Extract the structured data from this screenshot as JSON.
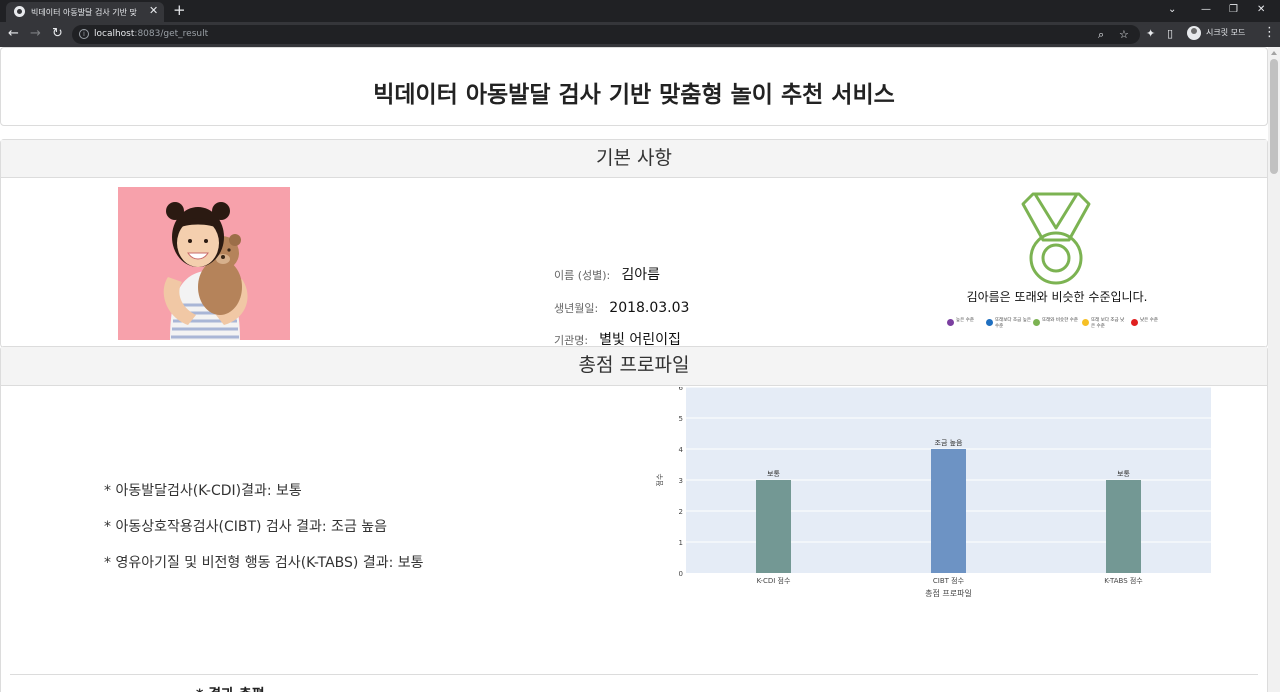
{
  "browser": {
    "tab_title": "빅데이터 아동발달 검사 기반 맞",
    "url_host": "localhost",
    "url_rest": ":8083/get_result",
    "profile_label": "시크릿 모드"
  },
  "page": {
    "title": "빅데이터 아동발달 검사 기반 맞춤형 놀이 추천 서비스",
    "basic_info": {
      "heading": "기본 사항",
      "name_label": "이름 (성별):",
      "name_value": "김아름",
      "birth_label": "생년월일:",
      "birth_value": "2018.03.03",
      "org_label": "기관명:",
      "org_value": "별빛 어린이집",
      "level_text": "김아름은 또래와 비슷한 수준입니다.",
      "medal_color": "#7cb352",
      "legend": [
        {
          "label": "높은 수준",
          "color": "#7b3fa0"
        },
        {
          "label": "또래보다 조금 높은 수준",
          "color": "#1f6fc0"
        },
        {
          "label": "또래와 비슷한 수준",
          "color": "#7cb352"
        },
        {
          "label": "또래 보다 조금 낮은 수준",
          "color": "#f6c026"
        },
        {
          "label": "낮은 수준",
          "color": "#e02020"
        }
      ]
    },
    "profile": {
      "heading": "총점 프로파일",
      "results": [
        "* 아동발달검사(K-CDI)결과: 보통",
        "* 아동상호작용검사(CIBT) 검사 결과: 조금 높음",
        "* 영유아기질 및 비전형 행동 검사(K-TABS) 결과: 보통"
      ]
    },
    "partial_heading": "* 결과 총평"
  },
  "chart_data": {
    "type": "bar",
    "categories": [
      "K-CDI 점수",
      "CIBT 점수",
      "K-TABS 점수"
    ],
    "values": [
      3,
      4,
      3
    ],
    "bar_labels": [
      "보통",
      "조금 높음",
      "보통"
    ],
    "bar_colors": [
      "#739894",
      "#6d93c4",
      "#739894"
    ],
    "xlabel": "총점 프로파일",
    "ylabel": "점수",
    "ylim": [
      0,
      6
    ],
    "yticks": [
      0,
      1,
      2,
      3,
      4,
      5,
      6
    ],
    "background": "#e5ecf6",
    "grid": true
  }
}
